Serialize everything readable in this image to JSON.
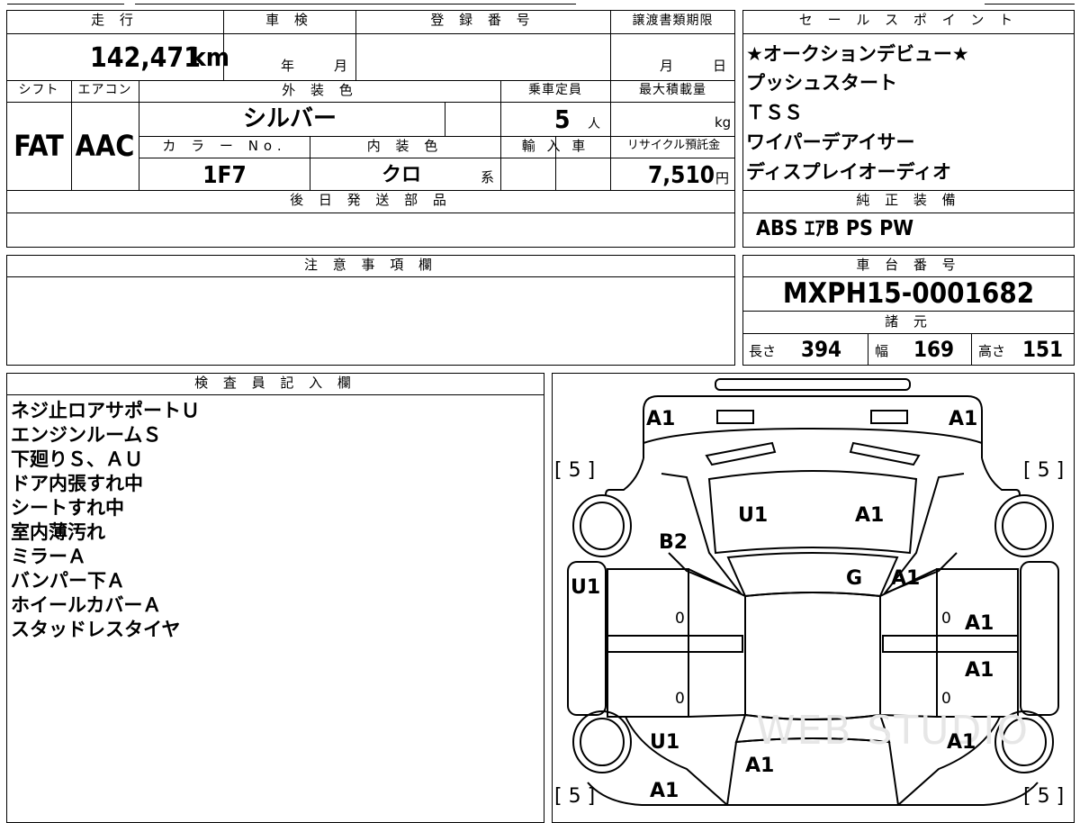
{
  "header": {
    "mileage_label": "走 行",
    "inspection_label": "車 検",
    "registration_label": "登 録 番 号",
    "transfer_deadline_label": "譲渡書類期限",
    "mileage_value": "142,471",
    "mileage_unit": "km",
    "inspection_year_unit": "年",
    "inspection_month_unit": "月",
    "transfer_month_unit": "月",
    "transfer_day_unit": "日",
    "shift_label": "シフト",
    "aircon_label": "エアコン",
    "exterior_color_label": "外 装 色",
    "capacity_label": "乗車定員",
    "max_load_label": "最大積載量",
    "shift_value": "FAT",
    "aircon_value": "AAC",
    "exterior_color_value": "シルバー",
    "capacity_value": "5",
    "capacity_unit": "人",
    "max_load_unit": "kg",
    "color_no_label": "カ ラ ー No.",
    "interior_color_label": "内 装 色",
    "import_label": "輸 入 車",
    "recycle_label": "リサイクル預託金",
    "color_no_value": "1F7",
    "interior_color_value": "クロ",
    "interior_color_suffix": "系",
    "recycle_value": "7,510",
    "recycle_unit": "円",
    "later_parts_label": "後 日 発 送 部 品"
  },
  "sales_points": {
    "label": "セ ー ル ス ポ イ ン ト",
    "items": [
      "★オークションデビュー★",
      "プッシュスタート",
      "ＴＳＳ",
      "ワイパーデアイサー",
      "ディスプレイオーディオ"
    ]
  },
  "genuine_equipment": {
    "label": "純 正 装 備",
    "value": "ABS ｴｱB PS PW"
  },
  "notes": {
    "label": "注 意 事 項 欄"
  },
  "chassis": {
    "label": "車 台 番 号",
    "value": "MXPH15-0001682",
    "specs_label": "諸 元",
    "length_label": "長さ",
    "length_value": "394",
    "width_label": "幅",
    "width_value": "169",
    "height_label": "高さ",
    "height_value": "151"
  },
  "inspector": {
    "label": "検 査 員 記 入 欄",
    "lines": [
      "ネジ止ロアサポートＵ",
      "エンジンルームＳ",
      "下廻りＳ、ＡＵ",
      "ドア内張すれ中",
      "シートすれ中",
      "室内薄汚れ",
      "ミラーＡ",
      "バンパー下Ａ",
      "ホイールカバーＡ",
      "スタッドレスタイヤ"
    ]
  },
  "diagram": {
    "marks": {
      "front_left": "A1",
      "front_right": "A1",
      "hood_left": "U1",
      "hood_right": "A1",
      "fender_left": "B2",
      "windshield": "G",
      "fender_right": "A1",
      "pillar_left": "U1",
      "rocker_right": "A1",
      "rear_door_right": "A1",
      "rear_fender_left": "U1",
      "rear_fender_right": "A1",
      "trunk": "A1",
      "rear_bumper_left": "A1"
    },
    "tire_tl": "[ 5 ]",
    "tire_tr": "[ 5 ]",
    "tire_bl": "[ 5 ]",
    "tire_br": "[ 5 ]",
    "door_fl": "0",
    "door_rl": "0",
    "door_fr": "0",
    "door_rr": "0",
    "watermark": "WEB STUDIO"
  }
}
